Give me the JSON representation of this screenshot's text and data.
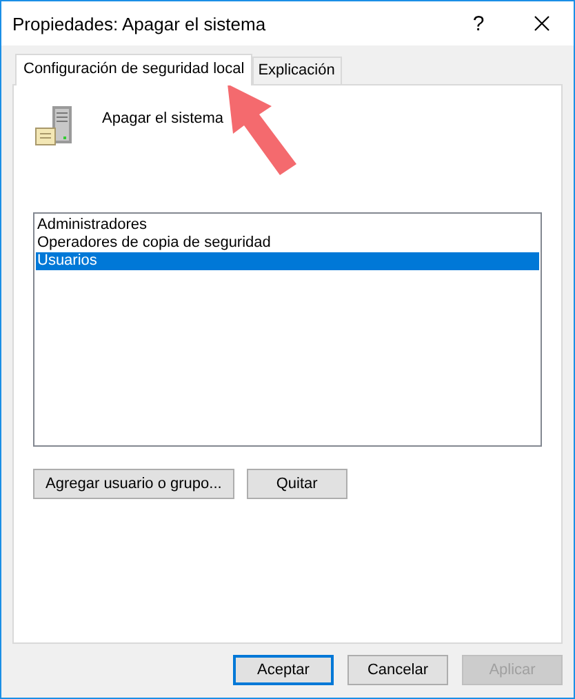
{
  "window": {
    "title": "Propiedades: Apagar el sistema",
    "controls": [
      "?"
    ]
  },
  "tabs": [
    {
      "label": "Configuración de seguridad local",
      "selected": true
    },
    {
      "label": "Explicación",
      "selected": false
    }
  ],
  "policy": {
    "name": "Apagar el sistema"
  },
  "list": [
    {
      "label": "Administradores",
      "selected": false
    },
    {
      "label": "Operadores de copia de seguridad",
      "selected": false
    },
    {
      "label": "Usuarios",
      "selected": true
    }
  ],
  "list_buttons": [
    {
      "label": "Agregar usuario o grupo...",
      "disabled": false
    },
    {
      "label": "Quitar",
      "disabled": false
    }
  ],
  "buttons": [
    {
      "label": "Aceptar",
      "default": true,
      "disabled": false
    },
    {
      "label": "Cancelar",
      "default": false,
      "disabled": false
    },
    {
      "label": "Aplicar",
      "default": false,
      "disabled": true
    }
  ]
}
